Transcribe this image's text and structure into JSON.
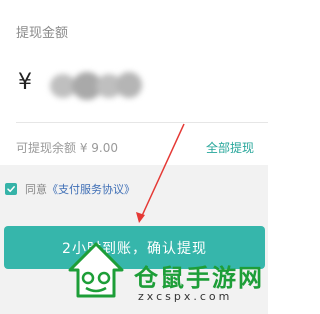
{
  "header": {
    "title": "提现金额"
  },
  "amount": {
    "currency_symbol": "¥",
    "value": ""
  },
  "balance": {
    "label": "可提现余额 ¥ 9.00",
    "withdraw_all_label": "全部提现"
  },
  "agreement": {
    "checked": true,
    "prefix": "同意",
    "link": "《支付服务协议》"
  },
  "confirm_button": {
    "label": "2小时到账，确认提现"
  },
  "watermark": {
    "cn": "仓鼠手游网",
    "en": "zxcspx.com"
  },
  "colors": {
    "accent": "#36b6ab",
    "link": "#3f6fb6",
    "annotation_arrow": "#e53935",
    "watermark_green": "#1d9e38"
  }
}
